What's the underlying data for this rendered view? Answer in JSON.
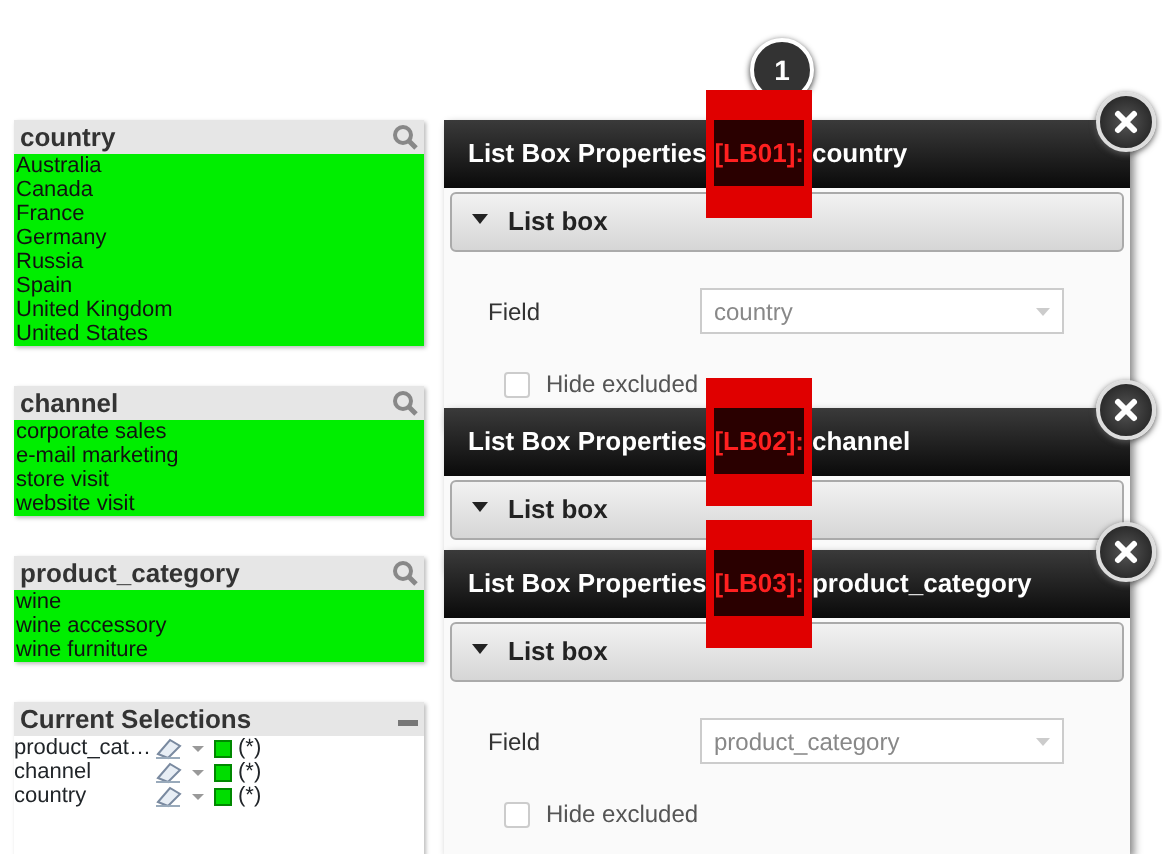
{
  "list_boxes": [
    {
      "title": "country",
      "items": [
        {
          "label": "Australia",
          "selected": true
        },
        {
          "label": "Canada",
          "selected": true
        },
        {
          "label": "France",
          "selected": true
        },
        {
          "label": "Germany",
          "selected": true
        },
        {
          "label": "Russia",
          "selected": true
        },
        {
          "label": "Spain",
          "selected": true
        },
        {
          "label": "United Kingdom",
          "selected": true
        },
        {
          "label": "United States",
          "selected": true
        }
      ]
    },
    {
      "title": "channel",
      "items": [
        {
          "label": "corporate sales",
          "selected": true
        },
        {
          "label": "e-mail marketing",
          "selected": true
        },
        {
          "label": "store visit",
          "selected": true
        },
        {
          "label": "website visit",
          "selected": true
        }
      ]
    },
    {
      "title": "product_category",
      "items": [
        {
          "label": "wine",
          "selected": true
        },
        {
          "label": "wine accessory",
          "selected": true
        },
        {
          "label": "wine furniture",
          "selected": true
        }
      ]
    }
  ],
  "current_selections": {
    "title": "Current Selections",
    "rows": [
      {
        "field": "product_cat…",
        "value": "(*)"
      },
      {
        "field": "channel",
        "value": "(*)"
      },
      {
        "field": "country",
        "value": "(*)"
      }
    ]
  },
  "step_badge": "1",
  "dialogs": [
    {
      "title": "List Box Properties",
      "id": "[LB01]:",
      "name": "country",
      "section": "List box",
      "expanded": true,
      "field_label": "Field",
      "field_value": "country",
      "hide_excluded": {
        "label": "Hide excluded",
        "checked": false
      }
    },
    {
      "title": "List Box Properties",
      "id": "[LB02]:",
      "name": "channel",
      "section": "List box",
      "expanded": true
    },
    {
      "title": "List Box Properties",
      "id": "[LB03]:",
      "name": "product_category",
      "section": "List box",
      "expanded": true,
      "field_label": "Field",
      "field_value": "product_category",
      "hide_excluded": {
        "label": "Hide excluded",
        "checked": false
      }
    }
  ]
}
